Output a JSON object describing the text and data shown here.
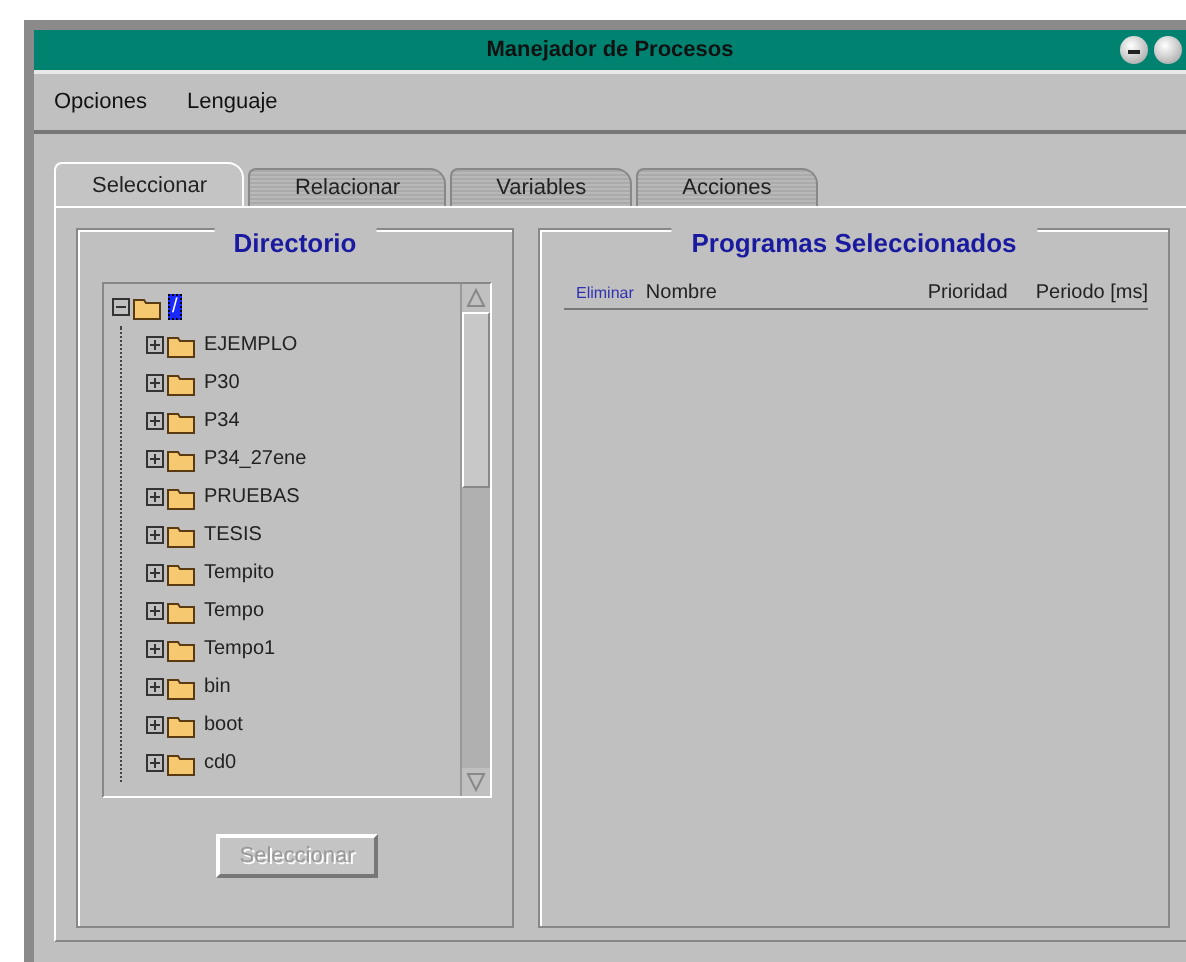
{
  "window": {
    "title": "Manejador de Procesos"
  },
  "menu": [
    "Opciones",
    "Lenguaje"
  ],
  "tabs": [
    {
      "label": "Seleccionar",
      "selected": true
    },
    {
      "label": "Relacionar",
      "selected": false
    },
    {
      "label": "Variables",
      "selected": false
    },
    {
      "label": "Acciones",
      "selected": false
    }
  ],
  "directory": {
    "title": "Directorio",
    "tree": [
      {
        "label": "/",
        "selected": true,
        "expanded": true,
        "children": [
          {
            "label": "EJEMPLO",
            "selected": false,
            "expanded": false
          },
          {
            "label": "P30",
            "selected": false,
            "expanded": false
          },
          {
            "label": "P34",
            "selected": false,
            "expanded": false
          },
          {
            "label": "P34_27ene",
            "selected": false,
            "expanded": false
          },
          {
            "label": "PRUEBAS",
            "selected": false,
            "expanded": false
          },
          {
            "label": "TESIS",
            "selected": false,
            "expanded": false
          },
          {
            "label": "Tempito",
            "selected": false,
            "expanded": false
          },
          {
            "label": "Tempo",
            "selected": false,
            "expanded": false
          },
          {
            "label": "Tempo1",
            "selected": false,
            "expanded": false
          },
          {
            "label": "bin",
            "selected": false,
            "expanded": false
          },
          {
            "label": "boot",
            "selected": false,
            "expanded": false
          },
          {
            "label": "cd0",
            "selected": false,
            "expanded": false
          }
        ]
      }
    ],
    "button": {
      "label": "Seleccionar",
      "disabled": true
    }
  },
  "programs": {
    "title": "Programas Seleccionados",
    "columns": [
      {
        "label": "Eliminar",
        "kind": "action"
      },
      {
        "label": "Nombre",
        "kind": "header"
      },
      {
        "label": "Prioridad",
        "kind": "header"
      },
      {
        "label": "Periodo [ms]",
        "kind": "header"
      }
    ]
  }
}
